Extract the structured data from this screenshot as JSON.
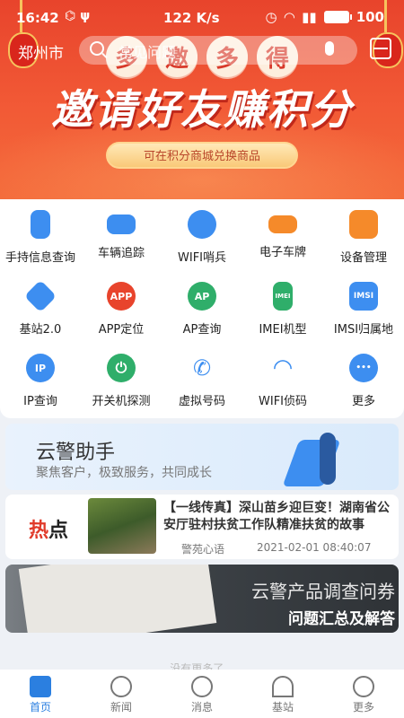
{
  "status": {
    "time": "16:42",
    "speed": "122 K/s",
    "battery": "100"
  },
  "header": {
    "city": "郑州市",
    "search_placeholder": "常见问题"
  },
  "banner": {
    "circles": [
      "多",
      "邀",
      "多",
      "得"
    ],
    "headline": "邀请好友赚积分",
    "sub": "可在积分商城兑换商品"
  },
  "grid": [
    {
      "label": "手持信息查询",
      "icon": "handheld-icon",
      "color": "#3d8ef0"
    },
    {
      "label": "车辆追踪",
      "icon": "car-icon",
      "color": "#3d8ef0"
    },
    {
      "label": "WIFI哨兵",
      "icon": "wifi-antenna-icon",
      "color": "#3d8ef0"
    },
    {
      "label": "电子车牌",
      "icon": "license-plate-icon",
      "color": "#f58a2a"
    },
    {
      "label": "设备管理",
      "icon": "device-icon",
      "color": "#f58a2a"
    },
    {
      "label": "基站2.0",
      "icon": "layers-icon",
      "color": "#3d8ef0"
    },
    {
      "label": "APP定位",
      "icon": "app-pin-icon",
      "color": "#e8442c"
    },
    {
      "label": "AP查询",
      "icon": "ap-search-icon",
      "color": "#2fae6a"
    },
    {
      "label": "IMEI机型",
      "icon": "imei-phone-icon",
      "color": "#2fae6a"
    },
    {
      "label": "IMSI归属地",
      "icon": "imsi-card-icon",
      "color": "#3d8ef0"
    },
    {
      "label": "IP查询",
      "icon": "ip-search-icon",
      "color": "#3d8ef0"
    },
    {
      "label": "开关机探测",
      "icon": "power-icon",
      "color": "#2fae6a"
    },
    {
      "label": "虚拟号码",
      "icon": "phone-call-icon",
      "color": "#3d8ef0"
    },
    {
      "label": "WIFI侦码",
      "icon": "wifi-icon",
      "color": "#3d8ef0"
    },
    {
      "label": "更多",
      "icon": "more-dots-icon",
      "color": "#3d8ef0"
    }
  ],
  "grid_icon_text": {
    "app": "APP",
    "ap": "AP",
    "imei": "IMEI",
    "imsi": "IMSI",
    "ip": "IP",
    "power": "⏻",
    "phone": "✆",
    "wifi": "◠",
    "more": "•••"
  },
  "assistant": {
    "title": "云警助手",
    "subtitle": "聚焦客户，极致服务，共同成长"
  },
  "news": {
    "tag_a": "热",
    "tag_b": "点",
    "title": "【一线传真】深山苗乡迎巨变！湖南省公安厅驻村扶贫工作队精准扶贫的故事",
    "source": "警苑心语",
    "date": "2021-02-01 08:40:07"
  },
  "survey": {
    "title": "云警产品调查问券",
    "subtitle": "问题汇总及解答"
  },
  "footer_note": "没有更多了...",
  "tabs": [
    {
      "label": "首页",
      "icon": "home-icon"
    },
    {
      "label": "新闻",
      "icon": "compass-icon"
    },
    {
      "label": "消息",
      "icon": "message-icon"
    },
    {
      "label": "基站",
      "icon": "signal-icon"
    },
    {
      "label": "更多",
      "icon": "user-icon"
    }
  ]
}
